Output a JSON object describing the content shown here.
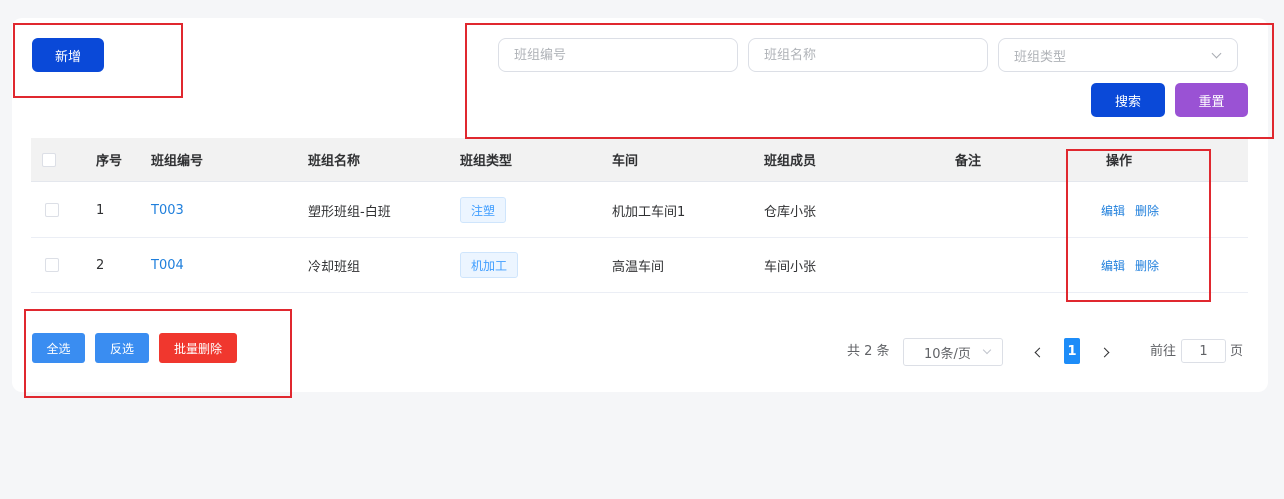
{
  "toolbar": {
    "add_label": "新增"
  },
  "search": {
    "code_placeholder": "班组编号",
    "name_placeholder": "班组名称",
    "type_placeholder": "班组类型",
    "search_label": "搜索",
    "reset_label": "重置"
  },
  "table": {
    "headers": {
      "index": "序号",
      "code": "班组编号",
      "name": "班组名称",
      "type": "班组类型",
      "workshop": "车间",
      "members": "班组成员",
      "remark": "备注",
      "actions": "操作"
    },
    "rows": [
      {
        "index": "1",
        "code": "T003",
        "name": "塑形班组-白班",
        "type": "注塑",
        "workshop": "机加工车间1",
        "members": "仓库小张",
        "remark": "",
        "edit": "编辑",
        "delete": "删除"
      },
      {
        "index": "2",
        "code": "T004",
        "name": "冷却班组",
        "type": "机加工",
        "workshop": "高温车间",
        "members": "车间小张",
        "remark": "",
        "edit": "编辑",
        "delete": "删除"
      }
    ]
  },
  "bulk": {
    "select_all": "全选",
    "invert": "反选",
    "batch_delete": "批量删除"
  },
  "pagination": {
    "total": "共 2 条",
    "page_size": "10条/页",
    "current_page": "1",
    "goto_label": "前往",
    "goto_value": "1",
    "goto_suffix": "页"
  },
  "colors": {
    "primary": "#0a49d8",
    "reset": "#9a52d4",
    "danger": "#f0372e",
    "secondary": "#3a8df1",
    "link": "#1f7fdc",
    "annotation": "#e0282f"
  }
}
